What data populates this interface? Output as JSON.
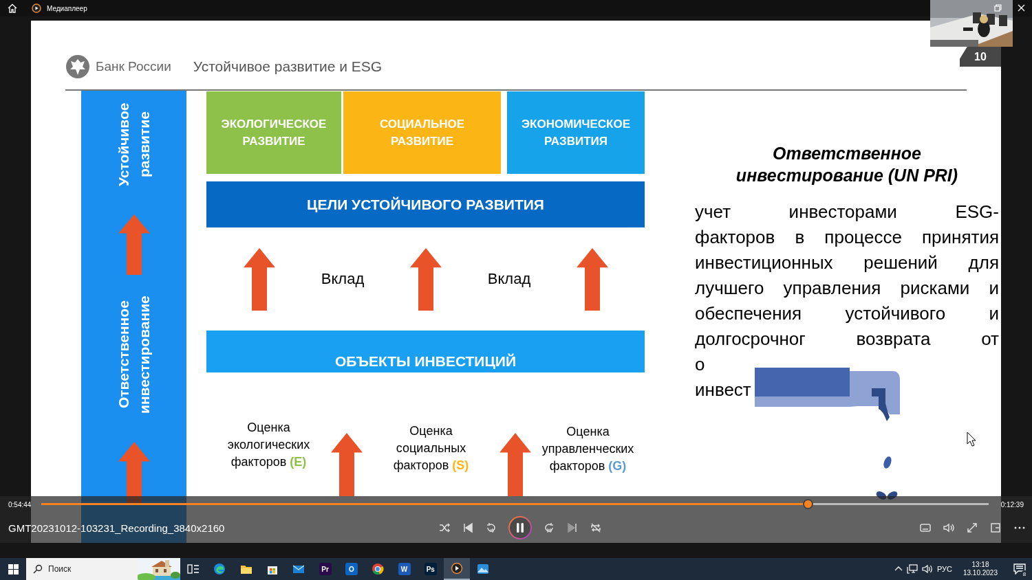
{
  "titlebar": {
    "title": "Медиаплеер"
  },
  "slide": {
    "org": "Банк России",
    "title": "Устойчивое развитие и ESG",
    "page": "10",
    "side_labels": [
      "Устойчивое развитие",
      "Ответственное инвестирование"
    ],
    "pillars": [
      {
        "label": "ЭКОЛОГИЧЕСКОЕ РАЗВИТИЕ",
        "color": "#8dc149"
      },
      {
        "label": "СОЦИАЛЬНОЕ РАЗВИТИЕ",
        "color": "#fbb515"
      },
      {
        "label": "ЭКОНОМИЧЕСКОЕ РАЗВИТИЯ",
        "color": "#16a3ea"
      }
    ],
    "goals_bar": "ЦЕЛИ УСТОЙЧИВОГО РАЗВИТИЯ",
    "contributions": [
      "Вклад",
      "Вклад"
    ],
    "objects_bar": "ОБЪЕКТЫ ИНВЕСТИЦИЙ",
    "assessments": [
      {
        "text": "Оценка экологических факторов",
        "code": "(E)",
        "color": "#8dc149"
      },
      {
        "text": "Оценка социальных факторов",
        "code": "(S)",
        "color": "#fbb515"
      },
      {
        "text": "Оценка управленческих факторов",
        "code": "(G)",
        "color": "#5b9bd5"
      }
    ],
    "definition": {
      "title": "Ответственное инвестирование (UN PRI)",
      "lines": [
        "учет инвесторами ESG-",
        "факторов в процессе принятия",
        "инвестиционных решений для",
        "лучшего управления рисками и",
        "обеспечения устойчивого и",
        "долгосрочног возврата от",
        "о",
        "инвест"
      ]
    }
  },
  "player": {
    "elapsed": "0:54:44",
    "remaining": "0:12:39",
    "level": 0.81,
    "file": "GMT20231012-103231_Recording_3840x2160",
    "playing": true
  },
  "taskbar": {
    "search_placeholder": "Поиск",
    "apps": [
      {
        "kind": "taskview",
        "selected": false
      },
      {
        "kind": "edge",
        "selected": false
      },
      {
        "kind": "explorer",
        "selected": false
      },
      {
        "kind": "store",
        "selected": false
      },
      {
        "kind": "mail",
        "selected": false
      },
      {
        "kind": "tile",
        "label": "Pr",
        "selected": false
      },
      {
        "kind": "tile",
        "label": "O",
        "selected": false
      },
      {
        "kind": "chrome",
        "selected": false
      },
      {
        "kind": "tile",
        "label": "W",
        "selected": false
      },
      {
        "kind": "tile",
        "label": "Ps",
        "selected": false
      },
      {
        "kind": "player",
        "selected": true
      },
      {
        "kind": "photos",
        "selected": false
      }
    ],
    "language": "РУС",
    "time": "13:18",
    "date": "13.10.2023",
    "notifications": "8"
  }
}
